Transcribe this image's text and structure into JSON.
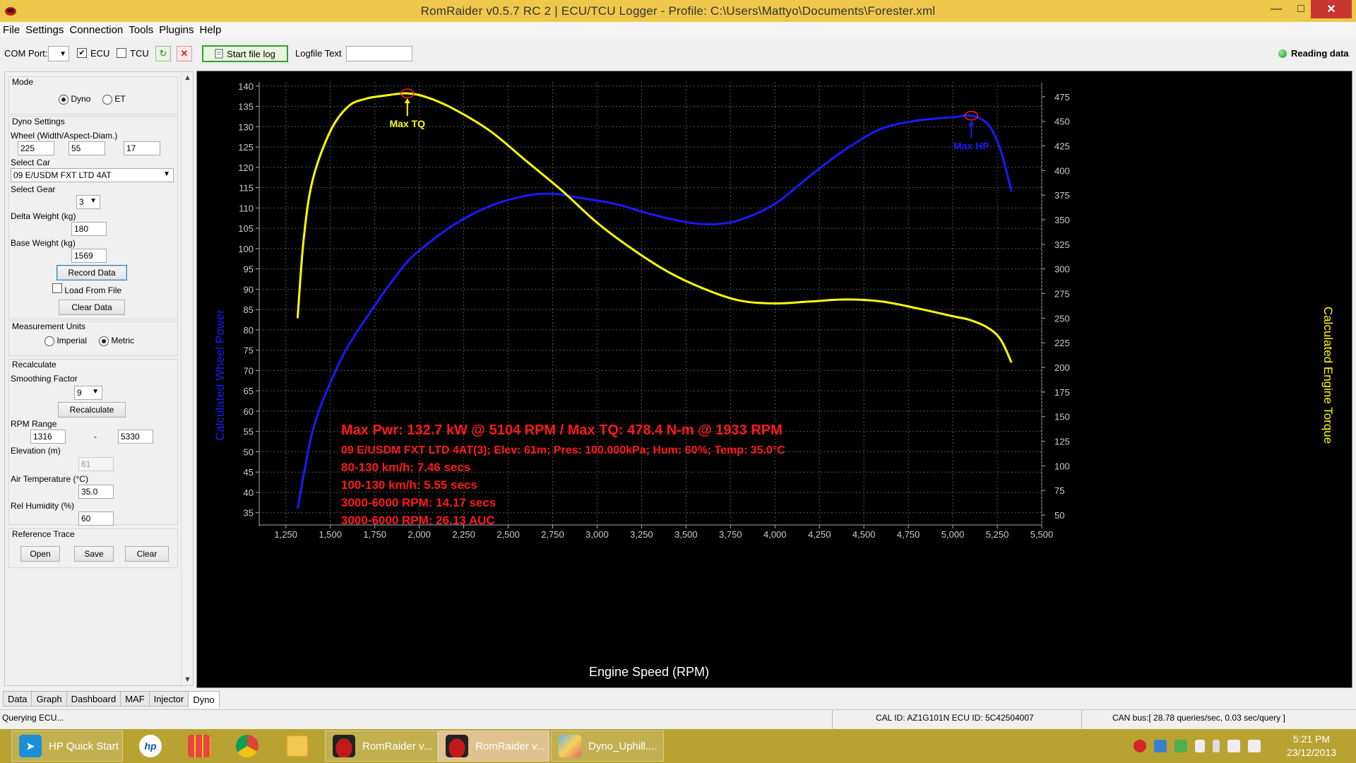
{
  "window": {
    "title": "RomRaider v0.5.7 RC 2 | ECU/TCU Logger - Profile: C:\\Users\\Mattyo\\Documents\\Forester.xml",
    "min_glyph": "—",
    "max_glyph": "□",
    "close_glyph": "✕"
  },
  "menu": [
    "File",
    "Settings",
    "Connection",
    "Tools",
    "Plugins",
    "Help"
  ],
  "toolbar": {
    "com_port_label": "COM Port:",
    "ecu_label": "ECU",
    "ecu_checked": true,
    "tcu_label": "TCU",
    "tcu_checked": false,
    "start_file_log": "Start file log",
    "logfile_text_label": "Logfile Text",
    "logfile_text_value": "",
    "reading_status": "Reading data",
    "checkmark": "✔",
    "refresh_glyph": "↻",
    "stop_glyph": "✕",
    "dropdown_glyph": "▼"
  },
  "dyno_panel": {
    "mode_title": "Mode",
    "mode_options": [
      "Dyno",
      "ET"
    ],
    "mode_selected": "Dyno",
    "settings_title": "Dyno Settings",
    "wheel_label": "Wheel (Width/Aspect-Diam.)",
    "wheel_width": "225",
    "wheel_aspect": "55",
    "wheel_diam": "17",
    "select_car_label": "Select Car",
    "car": "09 E/USDM FXT LTD 4AT",
    "select_gear_label": "Select Gear",
    "gear": "3",
    "delta_weight_label": "Delta Weight (kg)",
    "delta_weight": "180",
    "base_weight_label": "Base Weight (kg)",
    "base_weight": "1569",
    "record_data": "Record Data",
    "load_from_file": "Load From File",
    "clear_data": "Clear Data",
    "units_title": "Measurement Units",
    "unit_options": [
      "Imperial",
      "Metric"
    ],
    "unit_selected": "Metric",
    "recalc_title": "Recalculate",
    "smoothing_label": "Smoothing Factor",
    "smoothing": "9",
    "recalculate": "Recalculate",
    "rpm_range_label": "RPM Range",
    "rpm_min": "1316",
    "rpm_dash": "-",
    "rpm_max": "5330",
    "elevation_label": "Elevation (m)",
    "elevation": "61",
    "air_temp_label": "Air Temperature (°C)",
    "air_temp": "35.0",
    "humidity_label": "Rel Humidity (%)",
    "humidity": "60",
    "reference_title": "Reference Trace",
    "open": "Open",
    "save": "Save",
    "clear": "Clear",
    "scroll_up": "▲",
    "scroll_down": "▼"
  },
  "chart_data": {
    "type": "line",
    "xlabel": "Engine Speed (RPM)",
    "ylabel_left": "Calculated Wheel Power",
    "ylabel_right": "Calculated Engine Torque",
    "xlim": [
      1100,
      5500
    ],
    "ylim_left": [
      32,
      141
    ],
    "ylim_right": [
      40,
      490
    ],
    "x_ticks": [
      1250,
      1500,
      1750,
      2000,
      2250,
      2500,
      2750,
      3000,
      3250,
      3500,
      3750,
      4000,
      4250,
      4500,
      4750,
      5000,
      5250,
      5500
    ],
    "x_tick_labels": [
      "1,250",
      "1,500",
      "1,750",
      "2,000",
      "2,250",
      "2,500",
      "2,750",
      "3,000",
      "3,250",
      "3,500",
      "3,750",
      "4,000",
      "4,250",
      "4,500",
      "4,750",
      "5,000",
      "5,250",
      "5,500"
    ],
    "y_left_ticks": [
      35,
      40,
      45,
      50,
      55,
      60,
      65,
      70,
      75,
      80,
      85,
      90,
      95,
      100,
      105,
      110,
      115,
      120,
      125,
      130,
      135,
      140
    ],
    "y_right_ticks": [
      50,
      75,
      100,
      125,
      150,
      175,
      200,
      225,
      250,
      275,
      300,
      325,
      350,
      375,
      400,
      425,
      450,
      475
    ],
    "grid": true,
    "series": [
      {
        "name": "Calculated Wheel Power",
        "axis": "left",
        "color": "#1a1aff",
        "x": [
          1316,
          1400,
          1500,
          1600,
          1750,
          1900,
          2000,
          2200,
          2400,
          2600,
          2750,
          2900,
          3100,
          3300,
          3500,
          3650,
          3800,
          4000,
          4200,
          4400,
          4600,
          4800,
          5000,
          5104,
          5200,
          5270,
          5330
        ],
        "y": [
          36,
          55,
          67,
          76,
          86,
          95,
          99.5,
          106,
          110.5,
          113,
          113.5,
          112.5,
          111,
          108.5,
          106.5,
          106,
          107,
          111,
          118,
          124.5,
          129.5,
          131.5,
          132.3,
          132.7,
          130.5,
          124,
          114
        ]
      },
      {
        "name": "Calculated Engine Torque",
        "axis": "right",
        "color": "#ffff00",
        "x": [
          1316,
          1350,
          1400,
          1500,
          1600,
          1700,
          1800,
          1933,
          2050,
          2200,
          2400,
          2600,
          2800,
          3000,
          3200,
          3400,
          3600,
          3800,
          4000,
          4200,
          4400,
          4600,
          4800,
          5000,
          5100,
          5200,
          5270,
          5330
        ],
        "y": [
          250,
          330,
          390,
          440,
          465,
          473,
          476,
          478.4,
          474,
          462,
          440,
          410,
          380,
          347,
          320,
          297,
          280,
          268,
          265,
          267,
          269,
          267,
          260,
          252,
          248,
          240,
          228,
          205
        ]
      }
    ],
    "annotations": [
      {
        "text": "Max TQ",
        "color": "#ffff00",
        "x": 1933,
        "axis": "right",
        "y": 478.4
      },
      {
        "text": "Max HP",
        "color": "#1a1aff",
        "x": 5104,
        "axis": "left",
        "y": 132.7
      }
    ],
    "summary_lines": [
      "Max Pwr: 132.7 kW @ 5104 RPM / Max TQ: 478.4 N-m @ 1933 RPM",
      "09 E/USDM FXT LTD 4AT(3); Elev: 61m; Pres: 100.000kPa; Hum: 60%; Temp: 35.0°C",
      "80-130 km/h: 7.46 secs",
      "100-130 km/h: 5.55 secs",
      "3000-6000 RPM: 14.17 secs",
      "3000-6000 RPM: 26.13 AUC"
    ],
    "summary_color": "#ff1a1a"
  },
  "tabs": [
    "Data",
    "Graph",
    "Dashboard",
    "MAF",
    "Injector",
    "Dyno"
  ],
  "active_tab": "Dyno",
  "status": {
    "left": "Querying ECU...",
    "cal": "CAL ID: AZ1G101N  ECU ID: 5C42504007",
    "can": "CAN bus:[ 28.78 queries/sec, 0.03 sec/query ]"
  },
  "taskbar": {
    "hp_quick_start": "HP Quick Start",
    "romraider_1": "RomRaider v...",
    "romraider_2": "RomRaider v...",
    "dyno_uphill": "Dyno_Uphill....",
    "hp_logo": "hp",
    "time": "5:21 PM",
    "date": "23/12/2013"
  }
}
